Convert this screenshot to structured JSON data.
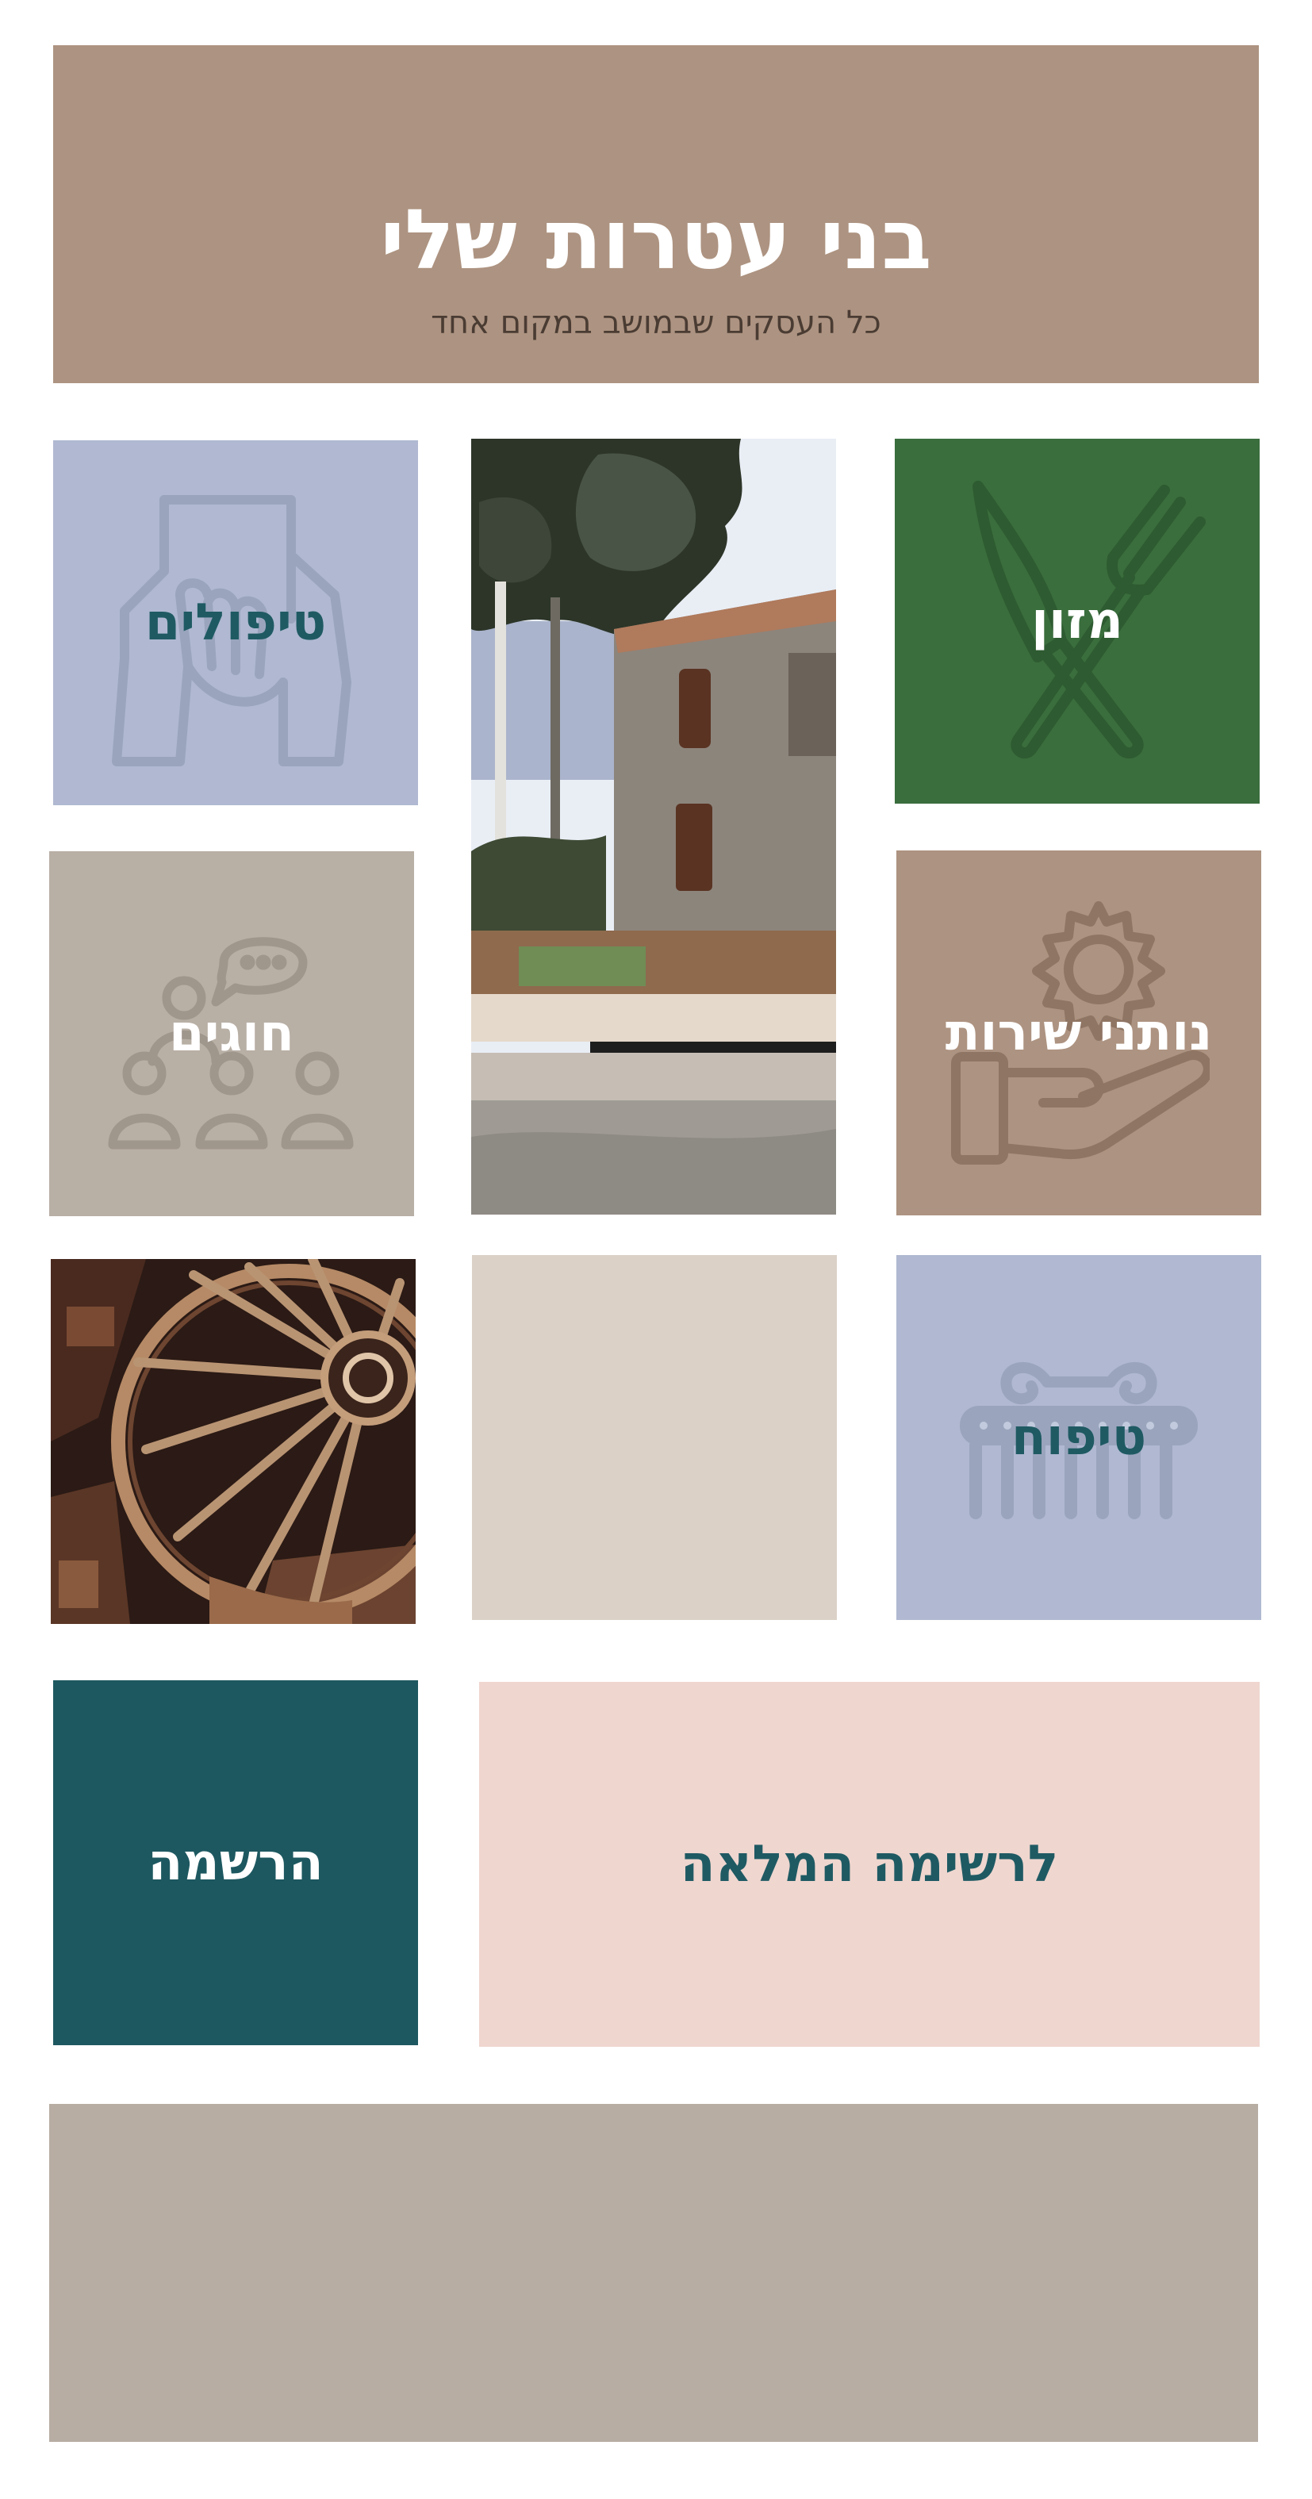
{
  "colors": {
    "header_bg": "#ad9381",
    "food_bg": "#3a6e3d",
    "therapy_bg": "#b0b9d1",
    "services_bg": "#ad9381",
    "classes_bg": "#b8afa5",
    "beauty_bg": "#b0b9d1",
    "empty_bg": "#dbd1c7",
    "register_bg": "#1d5860",
    "fulllist_bg": "#efd6cf",
    "footer_bg": "#b7ada2",
    "teal_text": "#1f5a63",
    "white_text": "#ffffff"
  },
  "header": {
    "title": "בני עטרות שלי",
    "subtitle": "כל העסקים שבמושב במקום אחד"
  },
  "tiles": {
    "food": {
      "label": "מזון",
      "icon": "fork-knife-icon"
    },
    "therapy": {
      "label": "טיפולים",
      "icon": "hands-icon"
    },
    "services": {
      "label": "נותני שירות",
      "icon": "gear-hand-icon"
    },
    "classes": {
      "label": "חוגים",
      "icon": "group-chat-icon"
    },
    "beauty": {
      "label": "טיפוח",
      "icon": "comb-icon"
    }
  },
  "photos": {
    "house": {
      "icon": "house-photo"
    },
    "wheel": {
      "icon": "wagon-wheel-photo"
    }
  },
  "buttons": {
    "full_list": "לרשימה המלאה",
    "register": "הרשמה"
  }
}
